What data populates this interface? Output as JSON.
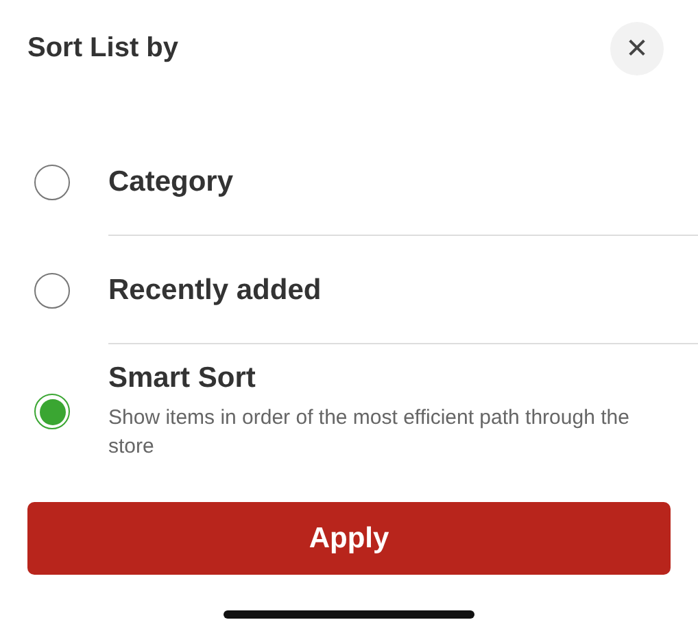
{
  "title": "Sort List by",
  "close": {
    "label": "✕"
  },
  "options": [
    {
      "label": "Category",
      "selected": false
    },
    {
      "label": "Recently added",
      "selected": false
    },
    {
      "label": "Smart Sort",
      "selected": true,
      "description": "Show items in order of the most efficient path through the store"
    }
  ],
  "apply": {
    "label": "Apply"
  }
}
